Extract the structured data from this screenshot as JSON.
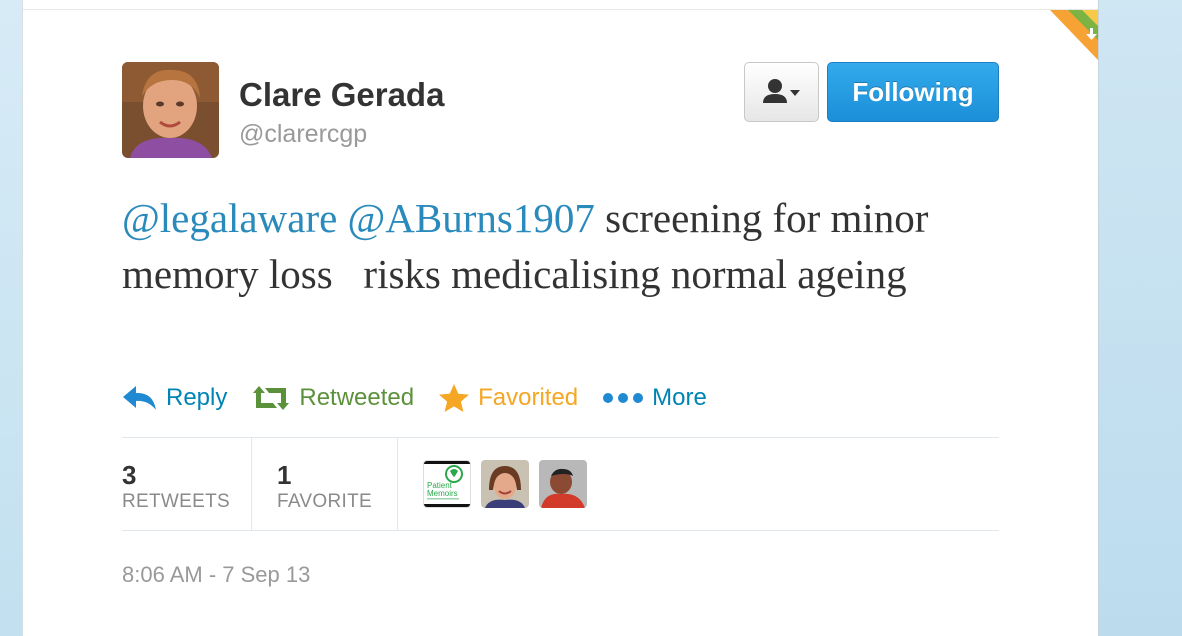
{
  "user": {
    "display_name": "Clare Gerada",
    "handle": "@clarercgp"
  },
  "buttons": {
    "user_menu": "user-dropdown-icon",
    "follow_label": "Following"
  },
  "tweet": {
    "mention1": "@legalaware",
    "mention2": "@ABurns1907",
    "text": " screening for minor memory loss   risks medicalising normal ageing"
  },
  "actions": {
    "reply": "Reply",
    "retweet": "Retweeted",
    "favorite": "Favorited",
    "more": "More"
  },
  "stats": {
    "retweets_count": "3",
    "retweets_label": "RETWEETS",
    "favorites_count": "1",
    "favorites_label": "FAVORITE"
  },
  "favoriters": {
    "patient_memoirs_line1": "Patient",
    "patient_memoirs_line2": "Memoirs"
  },
  "timestamp": "8:06 AM - 7 Sep 13",
  "colors": {
    "link": "#2b8abc",
    "follow_button": "#1b8fd8",
    "retweeted": "#5c913b",
    "favorited": "#f5a623"
  }
}
